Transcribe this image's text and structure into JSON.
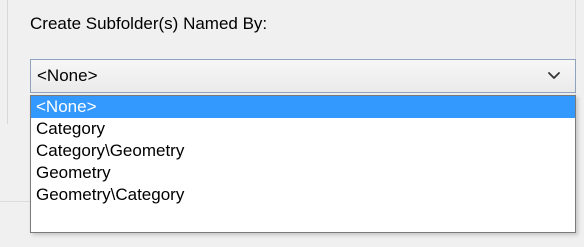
{
  "subfolder": {
    "label": "Create Subfolder(s) Named By:",
    "selected_value": "<None>",
    "chevron_icon": "chevron-down-icon",
    "options": [
      "<None>",
      "Category",
      "Category\\Geometry",
      "Geometry",
      "Geometry\\Category"
    ],
    "highlighted_option_index": 0,
    "highlight_color": "#3399ff"
  }
}
